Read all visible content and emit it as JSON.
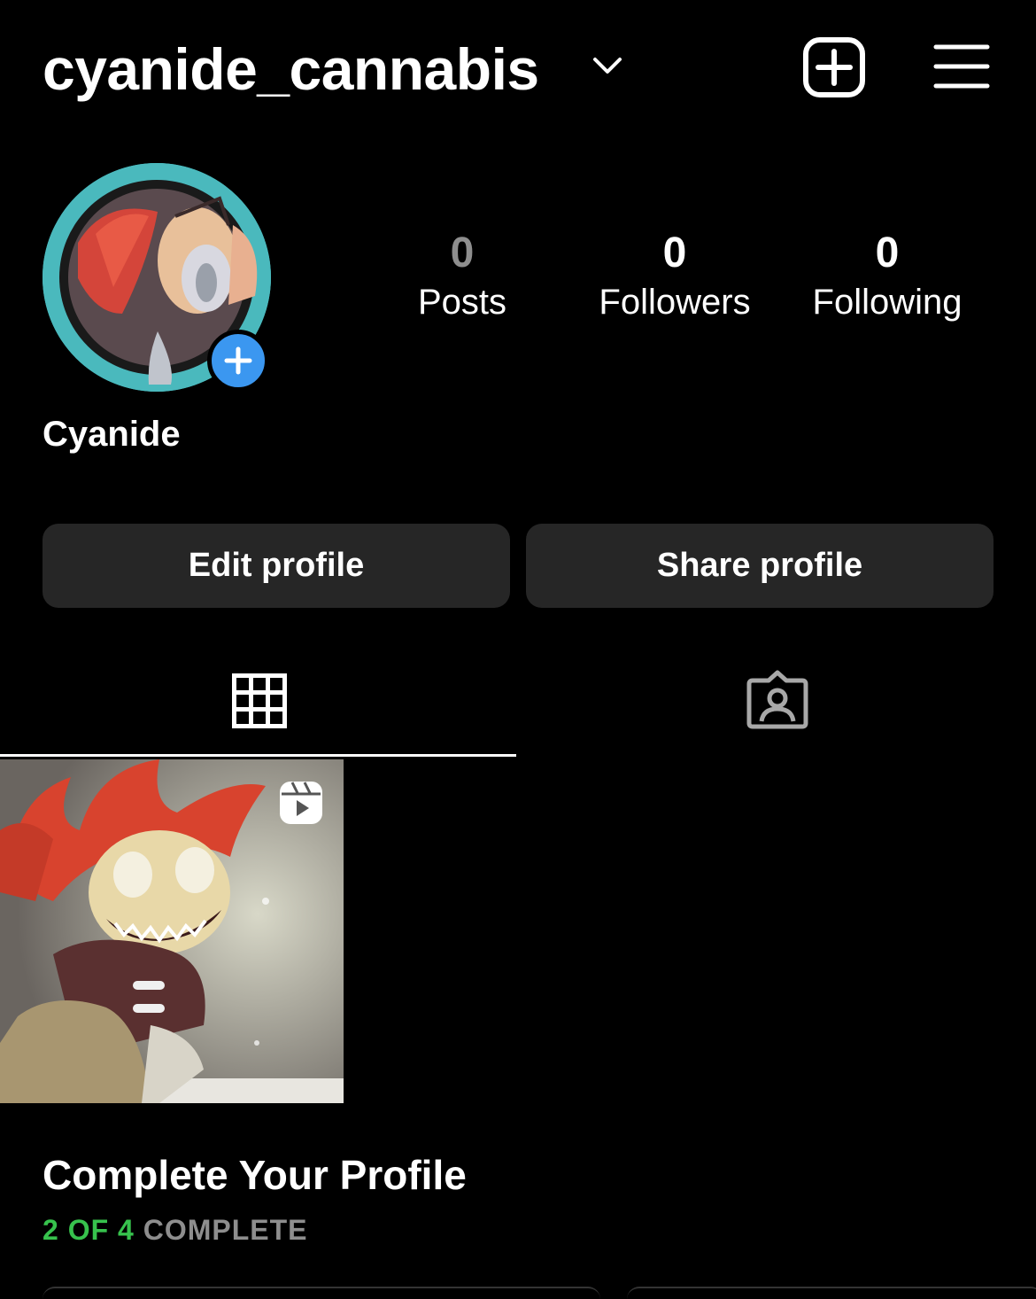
{
  "header": {
    "username": "cyanide_cannabis"
  },
  "profile": {
    "display_name": "Cyanide",
    "stats": [
      {
        "value": "0",
        "label": "Posts"
      },
      {
        "value": "0",
        "label": "Followers"
      },
      {
        "value": "0",
        "label": "Following"
      }
    ]
  },
  "buttons": {
    "edit": "Edit profile",
    "share": "Share profile"
  },
  "complete_profile": {
    "title": "Complete Your Profile",
    "progress_done": "2 OF 4",
    "progress_rest": " COMPLETE"
  },
  "colors": {
    "background": "#000000",
    "button_bg": "#262626",
    "accent_blue": "#3b97f0",
    "progress_green": "#37c24d",
    "muted": "#8e8e8e"
  },
  "icons": [
    "chevron-down-icon",
    "new-post-icon",
    "menu-icon",
    "plus-icon",
    "grid-icon",
    "tagged-icon",
    "reel-icon"
  ]
}
